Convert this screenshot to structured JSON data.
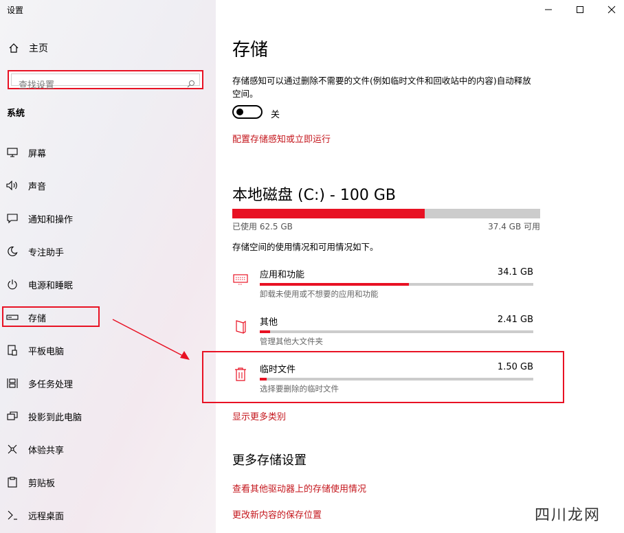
{
  "window": {
    "title": "设置"
  },
  "sidebar": {
    "home_label": "主页",
    "search_placeholder": "查找设置",
    "section": "系统",
    "items": [
      {
        "label": "屏幕",
        "icon": "monitor-icon"
      },
      {
        "label": "声音",
        "icon": "speaker-icon"
      },
      {
        "label": "通知和操作",
        "icon": "notification-icon"
      },
      {
        "label": "专注助手",
        "icon": "moon-icon"
      },
      {
        "label": "电源和睡眠",
        "icon": "power-icon"
      },
      {
        "label": "存储",
        "icon": "storage-icon",
        "selected": true
      },
      {
        "label": "平板电脑",
        "icon": "tablet-icon"
      },
      {
        "label": "多任务处理",
        "icon": "multitask-icon"
      },
      {
        "label": "投影到此电脑",
        "icon": "projection-icon"
      },
      {
        "label": "体验共享",
        "icon": "share-icon"
      },
      {
        "label": "剪贴板",
        "icon": "clipboard-icon"
      },
      {
        "label": "远程桌面",
        "icon": "remote-icon"
      }
    ]
  },
  "main": {
    "title": "存储",
    "storage_sense_desc": "存储感知可以通过删除不需要的文件(例如临时文件和回收站中的内容)自动释放空间。",
    "toggle_state": "关",
    "configure_link": "配置存储感知或立即运行",
    "disk_title": "本地磁盘 (C:) - 100 GB",
    "used_label": "已使用 62.5 GB",
    "available_label": "37.4 GB 可用",
    "used_fraction": 0.625,
    "usage_desc": "存储空间的使用情况和可用情况如下。",
    "categories": [
      {
        "name": "应用和功能",
        "size": "34.1 GB",
        "sub": "卸载未使用或不想要的应用和功能",
        "fraction": 0.545,
        "icon": "apps-icon"
      },
      {
        "name": "其他",
        "size": "2.41 GB",
        "sub": "管理其他大文件夹",
        "fraction": 0.038,
        "icon": "other-icon"
      },
      {
        "name": "临时文件",
        "size": "1.50 GB",
        "sub": "选择要删除的临时文件",
        "fraction": 0.024,
        "icon": "trash-icon"
      }
    ],
    "show_more_link": "显示更多类别",
    "more_settings_title": "更多存储设置",
    "other_drives_link": "查看其他驱动器上的存储使用情况",
    "save_location_link": "更改新内容的保存位置"
  },
  "watermark": "四川龙网",
  "colors": {
    "accent": "#e81123",
    "link": "#c4161c",
    "bar_bg": "#cccccc"
  }
}
